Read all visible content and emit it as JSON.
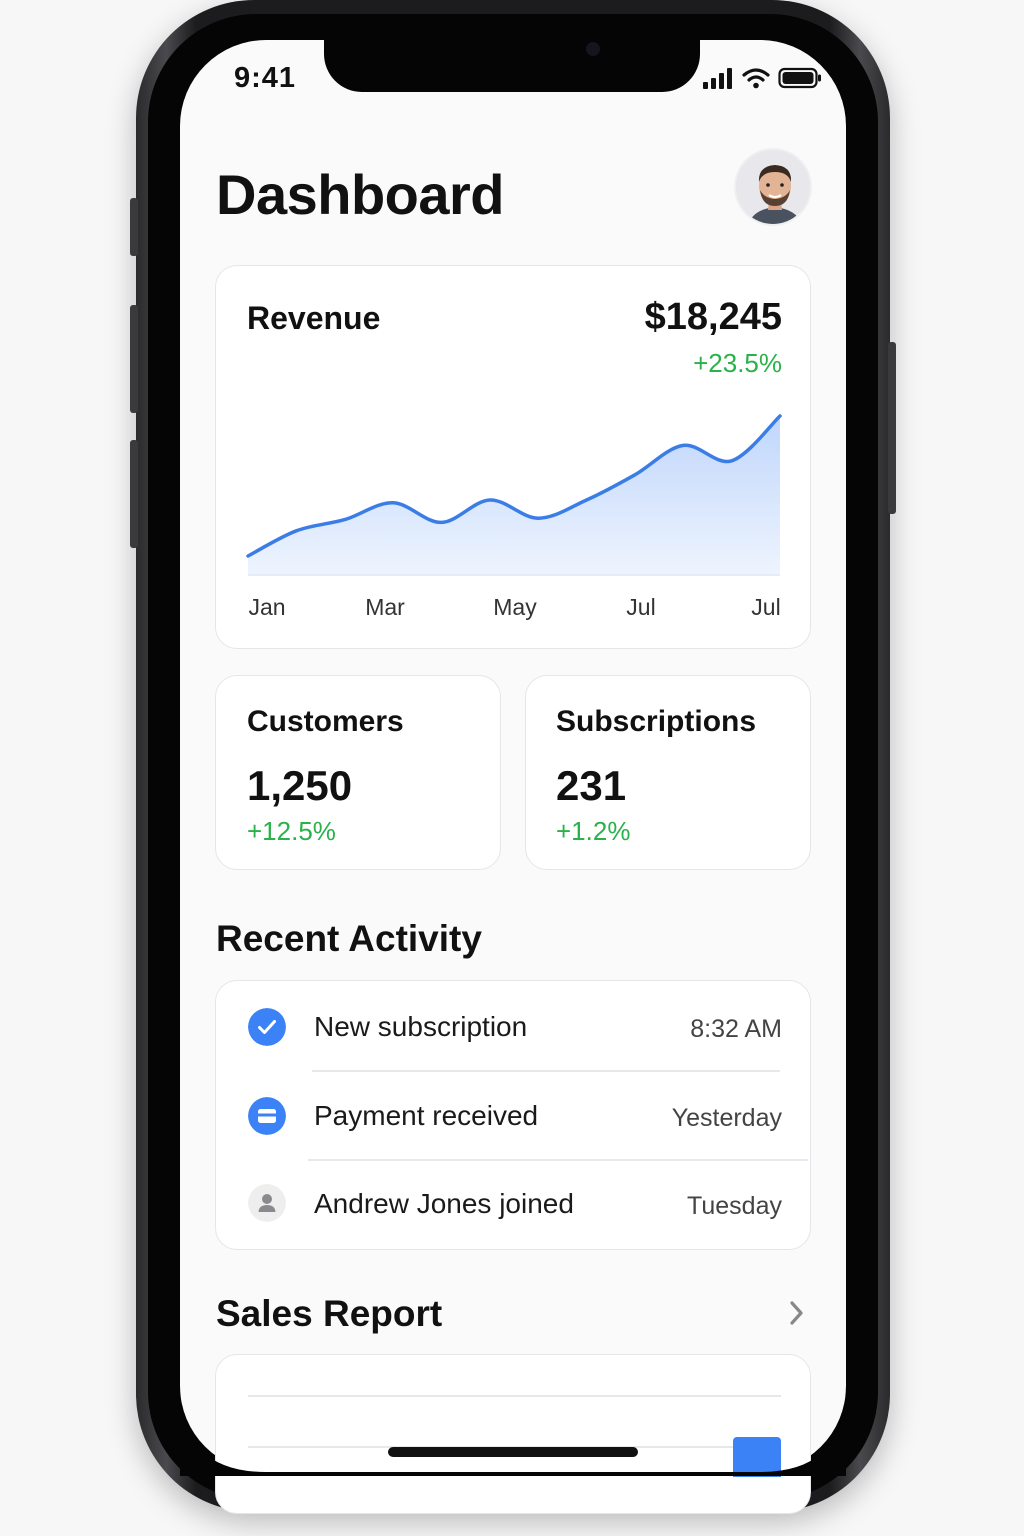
{
  "status_bar": {
    "time": "9:41"
  },
  "header": {
    "title": "Dashboard",
    "avatar_icon": "user-avatar"
  },
  "revenue": {
    "title": "Revenue",
    "amount": "$18,245",
    "change": "+23.5%",
    "change_color": "#2ab24a"
  },
  "chart_data": {
    "type": "area",
    "title": "Revenue",
    "x_tick_labels": [
      "Jan",
      "Mar",
      "May",
      "Jul",
      "Jul"
    ],
    "series": [
      {
        "values": [
          0.0,
          0.18,
          0.26,
          0.38,
          0.24,
          0.4,
          0.27,
          0.4,
          0.58,
          0.79,
          0.68,
          1.0
        ]
      }
    ],
    "line_color": "#3b7de6",
    "fill_color": "#bcd4fb",
    "grid": false
  },
  "stats": [
    {
      "label": "Customers",
      "value": "1,250",
      "change": "+12.5%"
    },
    {
      "label": "Subscriptions",
      "value": "231",
      "change": "+1.2%"
    }
  ],
  "activity": {
    "title": "Recent Activity",
    "items": [
      {
        "label": "New subscription",
        "time": "8:32 AM",
        "icon": "check-circle-icon",
        "icon_color": "#3b82f6"
      },
      {
        "label": "Payment received",
        "time": "Yesterday",
        "icon": "card-icon",
        "icon_color": "#3b82f6"
      },
      {
        "label": "Andrew Jones joined",
        "time": "Tuesday",
        "icon": "person-icon",
        "icon_color": "#eeeeef"
      }
    ]
  },
  "sales_report": {
    "title": "Sales Report",
    "chevron_icon": "chevron-right-icon"
  }
}
